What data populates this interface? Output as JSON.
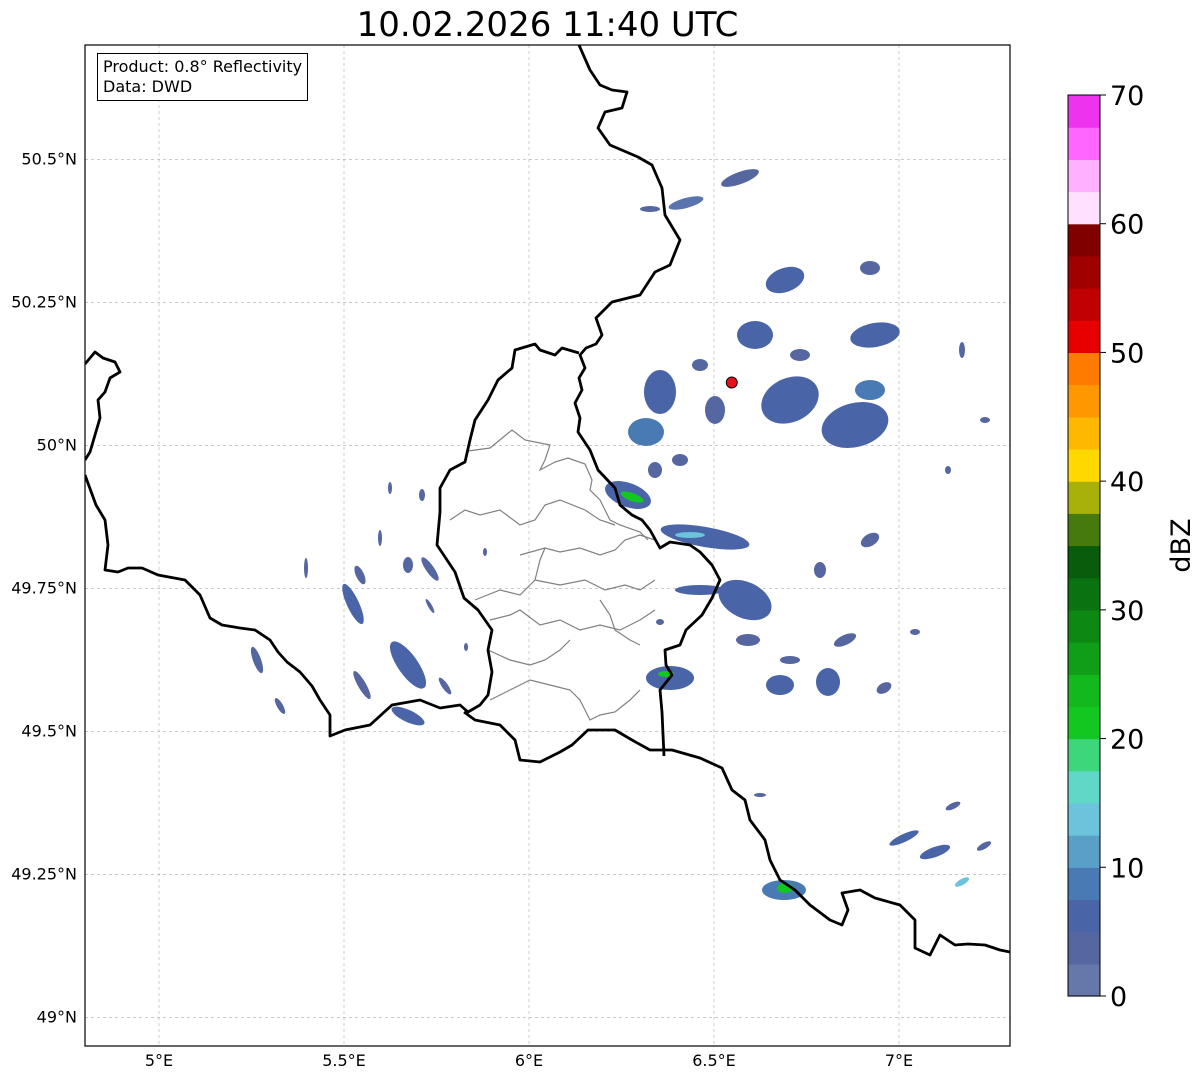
{
  "title": "10.02.2026 11:40 UTC",
  "info": {
    "product": "Product: 0.8° Reflectivity",
    "source": "Data: DWD"
  },
  "map": {
    "lon_range": [
      4.8,
      7.3
    ],
    "lat_range": [
      48.95,
      50.7
    ],
    "x_ticks": [
      {
        "v": 5.0,
        "label": "5°E"
      },
      {
        "v": 5.5,
        "label": "5.5°E"
      },
      {
        "v": 6.0,
        "label": "6°E"
      },
      {
        "v": 6.5,
        "label": "6.5°E"
      },
      {
        "v": 7.0,
        "label": "7°E"
      }
    ],
    "y_ticks": [
      {
        "v": 49.0,
        "label": "49°N"
      },
      {
        "v": 49.25,
        "label": "49.25°N"
      },
      {
        "v": 49.5,
        "label": "49.5°N"
      },
      {
        "v": 49.75,
        "label": "49.75°N"
      },
      {
        "v": 50.0,
        "label": "50°N"
      },
      {
        "v": 50.25,
        "label": "50.25°N"
      },
      {
        "v": 50.5,
        "label": "50.5°N"
      }
    ],
    "gridlines": true,
    "radar_site": {
      "lon": 6.548,
      "lat": 50.11,
      "color": "#e8101a"
    }
  },
  "colorbar": {
    "label": "dBZ",
    "min": 0,
    "max": 70,
    "step": 2.5,
    "ticks": [
      "0",
      "10",
      "20",
      "30",
      "40",
      "50",
      "60",
      "70"
    ],
    "colors": [
      "#6677aa",
      "#5566a0",
      "#4a64a8",
      "#4a7ab3",
      "#5a9fc8",
      "#6cc3dc",
      "#60d8c8",
      "#3ed67a",
      "#12c820",
      "#12b81c",
      "#109e18",
      "#0d8812",
      "#0a7210",
      "#085c0c",
      "#467a0c",
      "#a8b00a",
      "#ffd800",
      "#ffb800",
      "#ff9800",
      "#ff7c00",
      "#e80000",
      "#c00000",
      "#a00000",
      "#800000",
      "#ffe0ff",
      "#ffb0ff",
      "#ff66ff",
      "#ee33ee"
    ]
  }
}
